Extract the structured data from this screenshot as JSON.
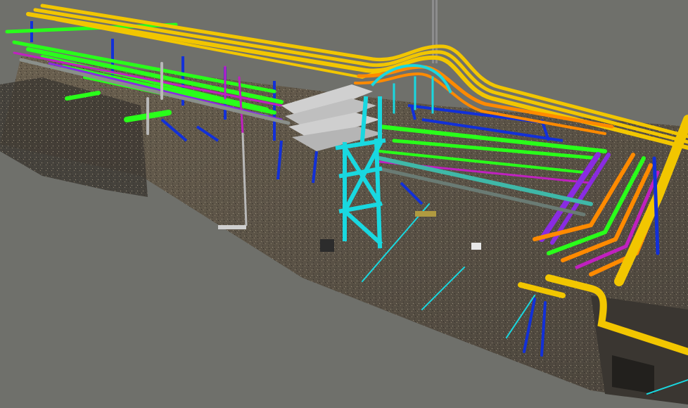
{
  "scene": {
    "background": "#6f706b",
    "palette": {
      "yellow_pipe": "#f2c600",
      "orange_pipe": "#ff8a00",
      "green_pipe": "#29ff1a",
      "cyan_steel": "#19d8e0",
      "blue_steel": "#1230d8",
      "magenta_pipe": "#c020c0",
      "purple_pipe": "#8a2be2",
      "grey_pipe": "#b8b8b8",
      "teal_pipe": "#3fb8a8",
      "ground": "#5e5548"
    }
  }
}
